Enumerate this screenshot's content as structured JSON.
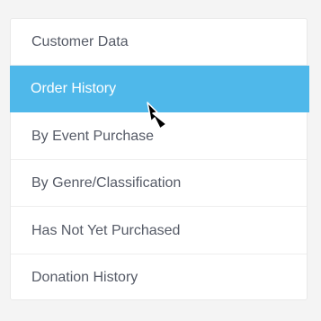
{
  "menu": {
    "items": [
      {
        "label": "Customer Data"
      },
      {
        "label": "Order History",
        "active": true
      },
      {
        "label": "By Event Purchase"
      },
      {
        "label": "By Genre/Classification"
      },
      {
        "label": "Has Not Yet Purchased"
      },
      {
        "label": "Donation History"
      }
    ]
  },
  "colors": {
    "active_background": "#4fb8ea",
    "text": "#555a66",
    "active_text": "#ffffff"
  },
  "cursor": {
    "icon": "mouse-pointer-icon"
  }
}
